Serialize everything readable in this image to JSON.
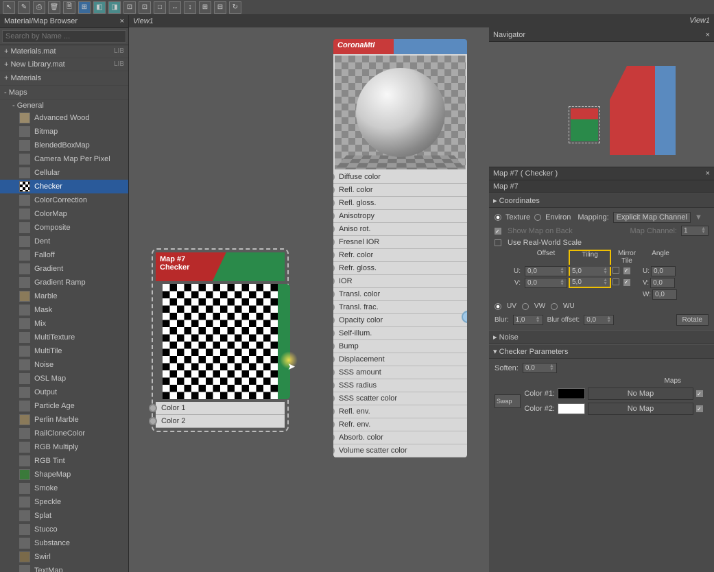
{
  "toolbar": [
    "↖",
    "✎",
    "⎙",
    "🗑",
    "🗎",
    "⊞",
    "◧",
    "◨",
    "⊡",
    "⊡",
    "□",
    "↔",
    "↕",
    "⊞",
    "⊟",
    "↻"
  ],
  "browser": {
    "title": "Material/Map Browser",
    "search_placeholder": "Search by Name ...",
    "libs": [
      {
        "name": "+ Materials.mat",
        "tag": "LIB"
      },
      {
        "name": "+ New Library.mat",
        "tag": "LIB"
      }
    ],
    "materials_section": "+ Materials",
    "maps_section": "- Maps",
    "general_section": "- General",
    "items": [
      {
        "label": "Advanced Wood",
        "icon": "tan"
      },
      {
        "label": "Bitmap",
        "icon": "gray"
      },
      {
        "label": "BlendedBoxMap",
        "icon": "gray"
      },
      {
        "label": "Camera Map Per Pixel",
        "icon": "gray"
      },
      {
        "label": "Cellular",
        "icon": "gray"
      },
      {
        "label": "Checker",
        "icon": "checker",
        "selected": true
      },
      {
        "label": "ColorCorrection",
        "icon": "gray"
      },
      {
        "label": "ColorMap",
        "icon": "gray"
      },
      {
        "label": "Composite",
        "icon": "gray"
      },
      {
        "label": "Dent",
        "icon": "gray"
      },
      {
        "label": "Falloff",
        "icon": "gray"
      },
      {
        "label": "Gradient",
        "icon": "gray"
      },
      {
        "label": "Gradient Ramp",
        "icon": "gray"
      },
      {
        "label": "Marble",
        "icon": "tan2"
      },
      {
        "label": "Mask",
        "icon": "gray"
      },
      {
        "label": "Mix",
        "icon": "gray"
      },
      {
        "label": "MultiTexture",
        "icon": "gray"
      },
      {
        "label": "MultiTile",
        "icon": "gray"
      },
      {
        "label": "Noise",
        "icon": "gray"
      },
      {
        "label": "OSL Map",
        "icon": "gray"
      },
      {
        "label": "Output",
        "icon": "gray"
      },
      {
        "label": "Particle Age",
        "icon": "gray"
      },
      {
        "label": "Perlin Marble",
        "icon": "tan2"
      },
      {
        "label": "RailCloneColor",
        "icon": "gray"
      },
      {
        "label": "RGB Multiply",
        "icon": "gray"
      },
      {
        "label": "RGB Tint",
        "icon": "gray"
      },
      {
        "label": "ShapeMap",
        "icon": "green"
      },
      {
        "label": "Smoke",
        "icon": "gray"
      },
      {
        "label": "Speckle",
        "icon": "gray"
      },
      {
        "label": "Splat",
        "icon": "gray"
      },
      {
        "label": "Stucco",
        "icon": "gray"
      },
      {
        "label": "Substance",
        "icon": "gray"
      },
      {
        "label": "Swirl",
        "icon": "brown"
      },
      {
        "label": "TextMap",
        "icon": "gray"
      }
    ]
  },
  "view_name": "View1",
  "nav_view_name": "View1",
  "navigator_title": "Navigator",
  "checker_node": {
    "title": "Map #7",
    "subtitle": "Checker",
    "color1": "Color 1",
    "color2": "Color 2"
  },
  "corona_node": {
    "title": "CoronaMtl",
    "slots": [
      "Diffuse color",
      "Refl. color",
      "Refl. gloss.",
      "Anisotropy",
      "Aniso rot.",
      "Fresnel IOR",
      "Refr. color",
      "Refr. gloss.",
      "IOR",
      "Transl. color",
      "Transl. frac.",
      "Opacity color",
      "Self-illum.",
      "Bump",
      "Displacement",
      "SSS amount",
      "SSS radius",
      "SSS scatter color",
      "Refl. env.",
      "Refr. env.",
      "Absorb. color",
      "Volume scatter color"
    ]
  },
  "props": {
    "header": "Map #7  ( Checker )",
    "name": "Map #7",
    "coordinates": {
      "title": "▸ Coordinates",
      "texture": "Texture",
      "environ": "Environ",
      "mapping_label": "Mapping:",
      "mapping_value": "Explicit Map Channel",
      "show_map": "Show Map on Back",
      "map_channel_label": "Map Channel:",
      "map_channel_value": "1",
      "real_world": "Use Real-World Scale",
      "col_offset": "Offset",
      "col_tiling": "Tiling",
      "col_mirror": "Mirror Tile",
      "col_angle": "Angle",
      "u_label": "U:",
      "v_label": "V:",
      "w_label": "W:",
      "offset_u": "0,0",
      "offset_v": "0,0",
      "tiling_u": "5,0",
      "tiling_v": "5,0",
      "angle_u": "0,0",
      "angle_v": "0,0",
      "angle_w": "0,0",
      "uv": "UV",
      "vw": "VW",
      "wu": "WU",
      "blur_label": "Blur:",
      "blur_value": "1,0",
      "blur_offset_label": "Blur offset:",
      "blur_offset_value": "0,0",
      "rotate": "Rotate"
    },
    "noise_title": "▸ Noise",
    "checker_params": {
      "title": "▾ Checker Parameters",
      "soften_label": "Soften:",
      "soften_value": "0,0",
      "maps_label": "Maps",
      "swap": "Swap",
      "color1_label": "Color #1:",
      "color2_label": "Color #2:",
      "nomap": "No Map"
    }
  }
}
